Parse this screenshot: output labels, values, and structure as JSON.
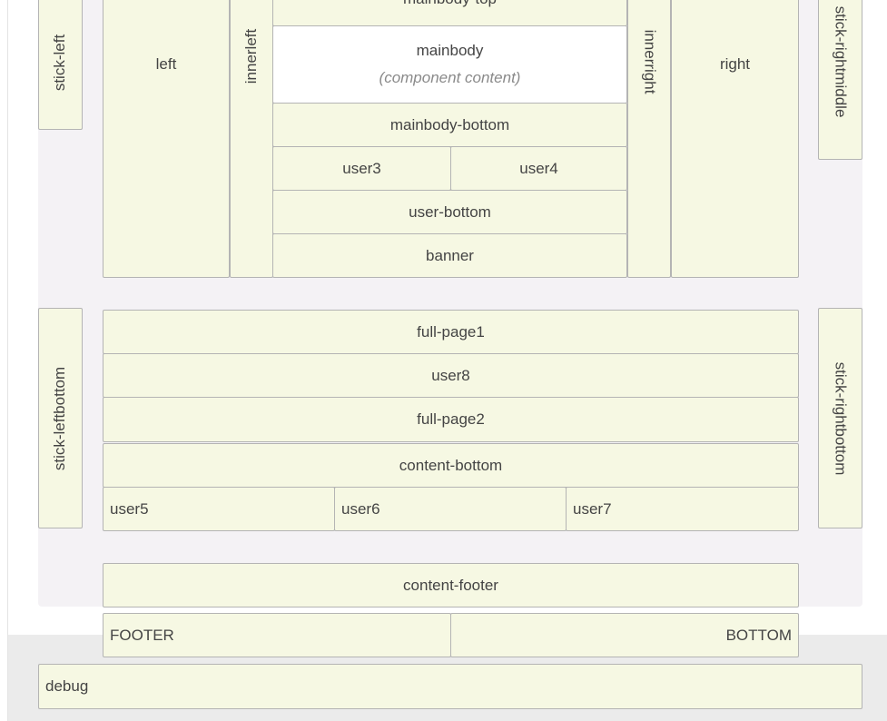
{
  "layout_blocks": {
    "top_partial": "mainbody-top",
    "stick_left": "stick-left",
    "stick_right": "stick-rightmiddle",
    "left": "left",
    "innerleft": "innerleft",
    "mainbody": "mainbody",
    "mainbody_note": "(component content)",
    "innerright": "innerright",
    "right": "right",
    "mainbody_bottom": "mainbody-bottom",
    "user3": "user3",
    "user4": "user4",
    "user_bottom": "user-bottom",
    "banner": "banner",
    "stick_leftbottom": "stick-leftbottom",
    "stick_rightbottom": "stick-rightbottom",
    "full_page1": "full-page1",
    "user8": "user8",
    "full_page2": "full-page2",
    "content_bottom": "content-bottom",
    "user5": "user5",
    "user6": "user6",
    "user7": "user7",
    "content_footer": "content-footer",
    "footer": "FOOTER",
    "bottom": "BOTTOM",
    "debug": "debug"
  }
}
